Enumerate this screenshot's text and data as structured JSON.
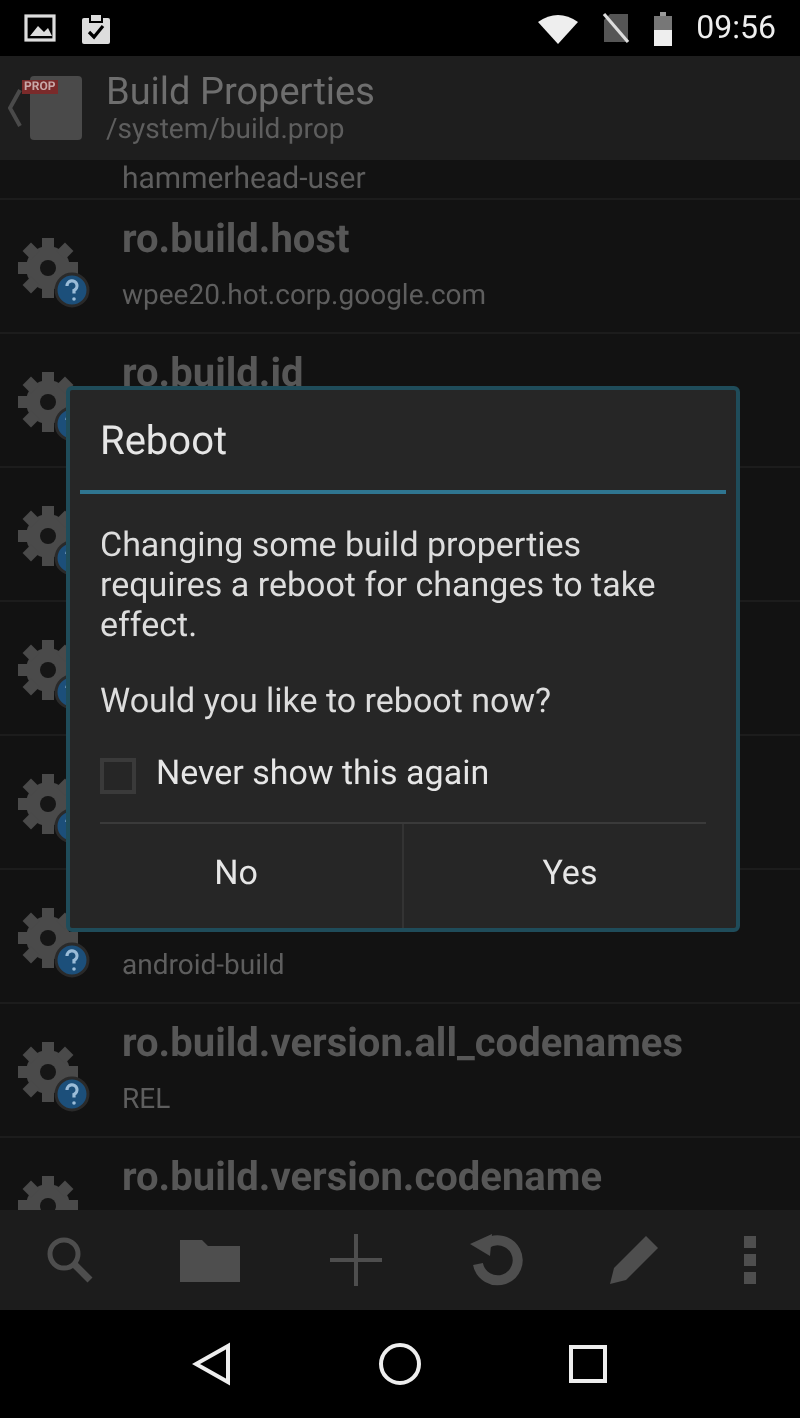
{
  "status_bar": {
    "time": "09:56"
  },
  "action_bar": {
    "icon_label": "PROP",
    "title": "Build Properties",
    "subtitle": "/system/build.prop"
  },
  "rows": [
    {
      "kind": "tail",
      "value": "hammerhead-user"
    },
    {
      "kind": "full",
      "name": "ro.build.host",
      "value": "wpee20.hot.corp.google.com"
    },
    {
      "kind": "full",
      "name": "ro.build.id"
    },
    {
      "kind": "full"
    },
    {
      "kind": "full"
    },
    {
      "kind": "full"
    },
    {
      "kind": "full",
      "value": "android-build"
    },
    {
      "kind": "full",
      "name": "ro.build.version.all_codenames",
      "value": "REL"
    },
    {
      "kind": "full",
      "name": "ro.build.version.codename"
    }
  ],
  "dialog": {
    "title": "Reboot",
    "message": "Changing some build properties requires a reboot for changes to take effect.",
    "question": "Would you like to reboot now?",
    "checkbox": {
      "label": "Never show this again",
      "checked": false
    },
    "buttons": [
      "No",
      "Yes"
    ]
  }
}
